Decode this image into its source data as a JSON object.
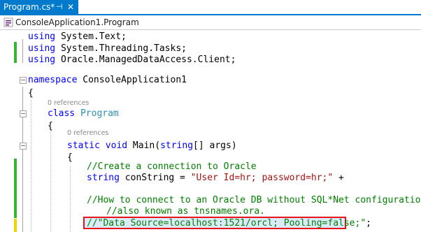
{
  "tab": {
    "title": "Program.cs*",
    "pin_icon": "pin-icon",
    "close_icon": "close-icon",
    "accent": "#007acc"
  },
  "navbar": {
    "icon": "csharp-class-icon",
    "label": "ConsoleApplication1.Program"
  },
  "colors": {
    "keyword": "#0000ff",
    "type": "#2b91af",
    "string": "#a31515",
    "comment": "#008000",
    "change_bar": "#33b533",
    "unsaved_bar": "#efd400",
    "highlight_border": "#e8141b"
  },
  "code": {
    "l1": {
      "kw": "using",
      "rest": " System.Text;"
    },
    "l2": {
      "kw": "using",
      "rest": " System.Threading.Tasks;"
    },
    "l3": {
      "kw": "using",
      "rest": " Oracle.ManagedDataAccess.Client;"
    },
    "l4": {
      "kw": "namespace",
      "rest": " ConsoleApplication1"
    },
    "l5": "{",
    "lens1": "0 references",
    "l6": {
      "kw": "class",
      "type": "Program"
    },
    "l7": "{",
    "lens2": "0 references",
    "l8": {
      "kw1": "static",
      "kw2": "void",
      "mid": " Main(",
      "kw3": "string",
      "rest": "[] args)"
    },
    "l9": "{",
    "l10": "//Create a connection to Oracle",
    "l11": {
      "kw": "string",
      "mid": " conString = ",
      "str": "\"User Id=hr; password=hr;\"",
      "rest": " +"
    },
    "l12": "//How to connect to an Oracle DB without SQL*Net configuration file",
    "l13": "//also known as tnsnames.ora.",
    "l14": {
      "cm": "//\"Data Source=localhost:1521/orcl; Pooling=false;\"",
      "rest": ";"
    }
  }
}
